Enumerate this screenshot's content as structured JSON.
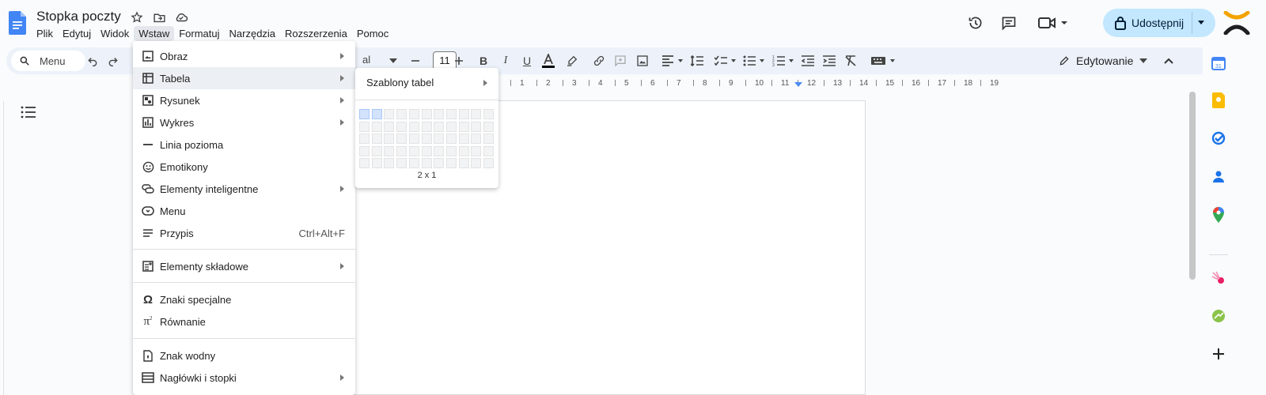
{
  "doc": {
    "title": "Stopka poczty"
  },
  "menubar": [
    {
      "label": "Plik",
      "name": "menu-file"
    },
    {
      "label": "Edytuj",
      "name": "menu-edit"
    },
    {
      "label": "Widok",
      "name": "menu-view"
    },
    {
      "label": "Wstaw",
      "name": "menu-insert",
      "active": true
    },
    {
      "label": "Formatuj",
      "name": "menu-format"
    },
    {
      "label": "Narzędzia",
      "name": "menu-tools"
    },
    {
      "label": "Rozszerzenia",
      "name": "menu-extensions"
    },
    {
      "label": "Pomoc",
      "name": "menu-help"
    }
  ],
  "header": {
    "share_label": "Udostępnij"
  },
  "toolbar": {
    "search_label": "Menu",
    "font_name": "al",
    "font_size": "11",
    "edit_mode_label": "Edytowanie"
  },
  "ruler": {
    "ticks": [
      "1",
      "2",
      "3",
      "4",
      "5",
      "6",
      "7",
      "8",
      "9",
      "10",
      "11",
      "12",
      "13",
      "14",
      "15",
      "16",
      "17",
      "18",
      "19"
    ]
  },
  "insert_menu": {
    "items": [
      {
        "label": "Obraz",
        "icon": "image-icon",
        "arrow": true
      },
      {
        "label": "Tabela",
        "icon": "table-icon",
        "arrow": true,
        "hover": true
      },
      {
        "label": "Rysunek",
        "icon": "drawing-icon",
        "arrow": true
      },
      {
        "label": "Wykres",
        "icon": "chart-icon",
        "arrow": true
      },
      {
        "label": "Linia pozioma",
        "icon": "horizontal-line-icon"
      },
      {
        "label": "Emotikony",
        "icon": "emoji-icon"
      },
      {
        "label": "Elementy inteligentne",
        "icon": "smart-chips-icon",
        "arrow": true
      },
      {
        "label": "Menu",
        "icon": "dropdown-chip-icon"
      },
      {
        "label": "Przypis",
        "icon": "footnote-icon",
        "shortcut": "Ctrl+Alt+F"
      },
      {
        "label": "Elementy składowe",
        "icon": "building-blocks-icon",
        "arrow": true
      },
      {
        "label": "Znaki specjalne",
        "icon": "omega-icon"
      },
      {
        "label": "Równanie",
        "icon": "pi-icon"
      },
      {
        "label": "Znak wodny",
        "icon": "watermark-icon"
      },
      {
        "label": "Nagłówki i stopki",
        "icon": "headers-footers-icon",
        "arrow": true
      }
    ]
  },
  "table_submenu": {
    "templates_label": "Szablony tabel",
    "grid_label": "2 x 1",
    "grid_cols": 11,
    "grid_rows": 5,
    "selected_cols": 2,
    "selected_rows": 1
  }
}
